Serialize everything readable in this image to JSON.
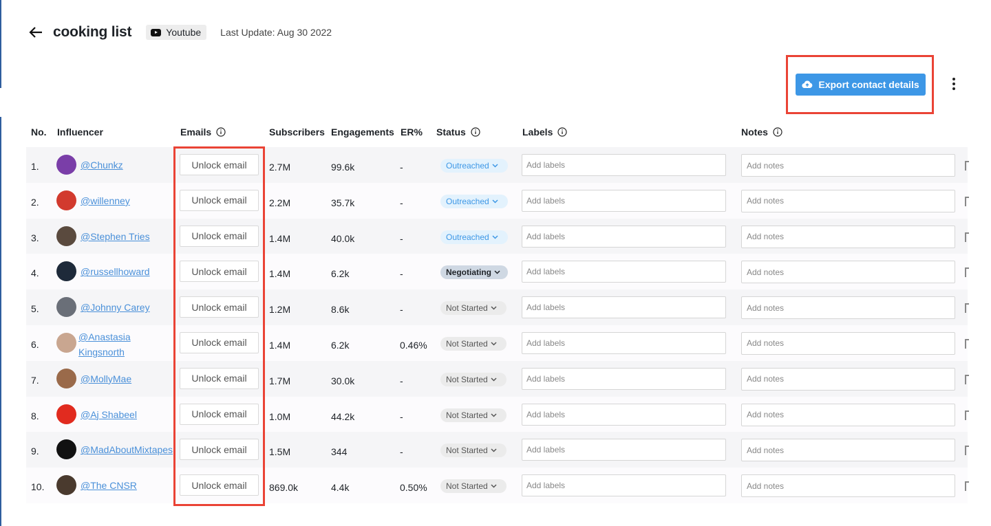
{
  "header": {
    "title": "cooking list",
    "platform": "Youtube",
    "last_update": "Last Update: Aug 30 2022"
  },
  "toolbar": {
    "export_label": "Export contact details"
  },
  "columns": {
    "no": "No.",
    "influencer": "Influencer",
    "emails": "Emails",
    "subscribers": "Subscribers",
    "engagements": "Engagements",
    "er": "ER%",
    "status": "Status",
    "labels": "Labels",
    "notes": "Notes"
  },
  "placeholders": {
    "labels": "Add labels",
    "notes": "Add notes"
  },
  "unlock_label": "Unlock email",
  "status_options": {
    "outreached": "Outreached",
    "negotiating": "Negotiating",
    "not_started": "Not Started"
  },
  "colors": {
    "accent": "#3d97e6",
    "highlight": "#ea4335"
  },
  "rows": [
    {
      "no": "1.",
      "name": "@Chunkz",
      "subs": "2.7M",
      "eng": "99.6k",
      "er": "-",
      "status": "Outreached",
      "status_key": "outreached",
      "avatar": "#7a3ea8"
    },
    {
      "no": "2.",
      "name": "@willenney",
      "subs": "2.2M",
      "eng": "35.7k",
      "er": "-",
      "status": "Outreached",
      "status_key": "outreached",
      "avatar": "#d23a2e"
    },
    {
      "no": "3.",
      "name": "@Stephen Tries",
      "subs": "1.4M",
      "eng": "40.0k",
      "er": "-",
      "status": "Outreached",
      "status_key": "outreached",
      "avatar": "#5a4a3e"
    },
    {
      "no": "4.",
      "name": "@russellhoward",
      "subs": "1.4M",
      "eng": "6.2k",
      "er": "-",
      "status": "Negotiating",
      "status_key": "negotiating",
      "avatar": "#1e2a3a"
    },
    {
      "no": "5.",
      "name": "@Johnny Carey",
      "subs": "1.2M",
      "eng": "8.6k",
      "er": "-",
      "status": "Not Started",
      "status_key": "not-started",
      "avatar": "#6a6f78"
    },
    {
      "no": "6.",
      "name": "@Anastasia Kingsnorth",
      "subs": "1.4M",
      "eng": "6.2k",
      "er": "0.46%",
      "status": "Not Started",
      "status_key": "not-started",
      "avatar": "#c9a690"
    },
    {
      "no": "7.",
      "name": "@MollyMae",
      "subs": "1.7M",
      "eng": "30.0k",
      "er": "-",
      "status": "Not Started",
      "status_key": "not-started",
      "avatar": "#9a6a4a"
    },
    {
      "no": "8.",
      "name": "@Aj Shabeel",
      "subs": "1.0M",
      "eng": "44.2k",
      "er": "-",
      "status": "Not Started",
      "status_key": "not-started",
      "avatar": "#e12b1f"
    },
    {
      "no": "9.",
      "name": "@MadAboutMixtapes",
      "subs": "1.5M",
      "eng": "344",
      "er": "-",
      "status": "Not Started",
      "status_key": "not-started",
      "avatar": "#111111"
    },
    {
      "no": "10.",
      "name": "@The CNSR",
      "subs": "869.0k",
      "eng": "4.4k",
      "er": "0.50%",
      "status": "Not Started",
      "status_key": "not-started",
      "avatar": "#4a3a2e"
    }
  ]
}
